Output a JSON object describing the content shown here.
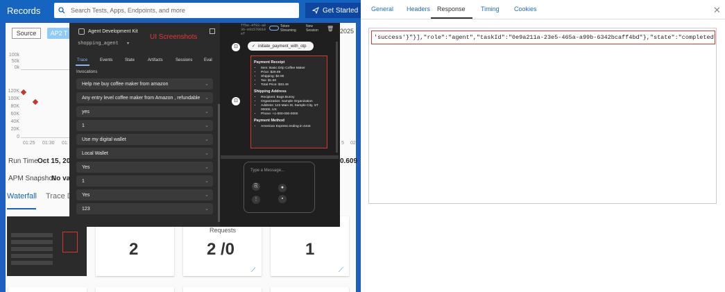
{
  "header": {
    "title": "Records",
    "search_placeholder": "Search Tests, Apps, Endpoints, and more",
    "get_started": "Get Started"
  },
  "bg": {
    "source_btn": "Source",
    "ap2_btn": "AP2 T",
    "top_ticks": [
      "100k",
      "50k",
      "0k"
    ],
    "y_ticks": [
      "120K",
      "100K",
      "80K",
      "60K",
      "40K",
      "20K",
      "0"
    ],
    "x_ticks": [
      "01:25",
      "01:30",
      "01:"
    ],
    "right_x_ticks": [
      "5",
      "02"
    ],
    "run_time_label": "Run Time",
    "run_time_value": "Oct 15, 202",
    "right_value": "0.609",
    "apm_label": "APM Snapshot",
    "apm_value": "No va",
    "tab_waterfall": "Waterfall",
    "tab_trace": "Trace D",
    "cards": [
      {
        "value": "2"
      },
      {
        "title": "Requests",
        "value": "2 /0"
      },
      {
        "value": "1"
      }
    ],
    "date_frag": "2025"
  },
  "overlay": {
    "title": "Agent Development Kit",
    "agent": "shopping_agent",
    "watermark": "UI Screenshots",
    "tabs": [
      "Trace",
      "Events",
      "State",
      "Artifacts",
      "Sessions",
      "Eval"
    ],
    "invocations_label": "Invocations",
    "items": [
      "Help me buy coffee maker from amazon",
      "Any entry level coffee maker from Amazon , refundable",
      "yes",
      "1",
      "Use my digital wallet",
      "Local Wallet",
      "Yes",
      "1",
      "Yes",
      "123"
    ],
    "session_id": "ffbe-4f93-a936-e91570010ef",
    "token_streaming": "Token Streaming",
    "new_session": "New Session",
    "tool_call": "initiate_payment_with_otp",
    "receipt": {
      "title": "Payment Receipt",
      "items": [
        "Item: Basic Drip Coffee Maker",
        "Price: $29.99",
        "Shipping: $2.00",
        "Tax: $1.50",
        "Total Price: $33.49"
      ],
      "ship_title": "Shipping Address",
      "ship_items": [
        "Recipient: Bugs Bunny",
        "Organization: Sample Organization",
        "Address: 123 Main St, Sample City, ST 00000, US",
        "Phone: +1-000-000-0000"
      ],
      "pay_title": "Payment Method",
      "pay_items": [
        "American Express ending in 4444"
      ]
    },
    "message_placeholder": "Type a Message..."
  },
  "panel": {
    "tabs": [
      "General",
      "Headers",
      "Response",
      "Timing",
      "Cookies"
    ],
    "response_line": "'success'}\"}],\"role\":\"agent\",\"taskId\":\"0e9a211a-23e5-465a-a99b-6342bcaff4bd\"},\"state\":\"completed\""
  },
  "colors": {
    "brand": "#1565c0",
    "highlight": "#d9372b",
    "link": "#1e6bd6"
  }
}
